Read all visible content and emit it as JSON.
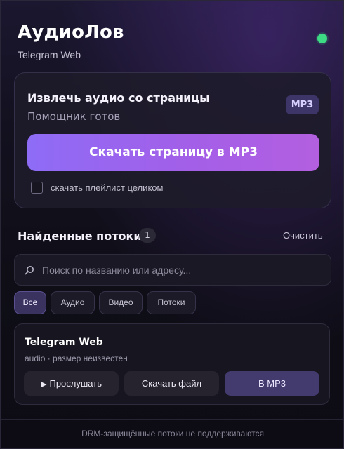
{
  "header": {
    "title": "АудиоЛов",
    "subtitle": "Telegram Web",
    "status_color": "#3ddc84"
  },
  "extract_card": {
    "title": "Извлечь аудио со страницы",
    "status": "Помощник готов",
    "format_badge": "MP3",
    "primary_button": "Скачать страницу в MP3",
    "playlist_checkbox": {
      "label": "скачать плейлист целиком",
      "checked": false
    }
  },
  "streams_section": {
    "title": "Найденные потоки",
    "count": "1",
    "clear_label": "Очистить",
    "search": {
      "placeholder": "Поиск по названию или адресу...",
      "value": ""
    },
    "filters": [
      {
        "label": "Все",
        "active": true
      },
      {
        "label": "Аудио",
        "active": false
      },
      {
        "label": "Видео",
        "active": false
      },
      {
        "label": "Потоки",
        "active": false
      }
    ],
    "items": [
      {
        "title": "Telegram Web",
        "meta": "audio · размер неизвестен",
        "play_icon": "play-icon",
        "play_label": "Прослушать",
        "download_label": "Скачать файл",
        "convert_label": "В MP3"
      }
    ]
  },
  "footer": {
    "note": "DRM-защищённые потоки не поддерживаются"
  },
  "colors": {
    "accent_gradient_start": "#8e6cf6",
    "accent_gradient_end": "#b35fe0",
    "badge_bg": "#3d3568"
  }
}
